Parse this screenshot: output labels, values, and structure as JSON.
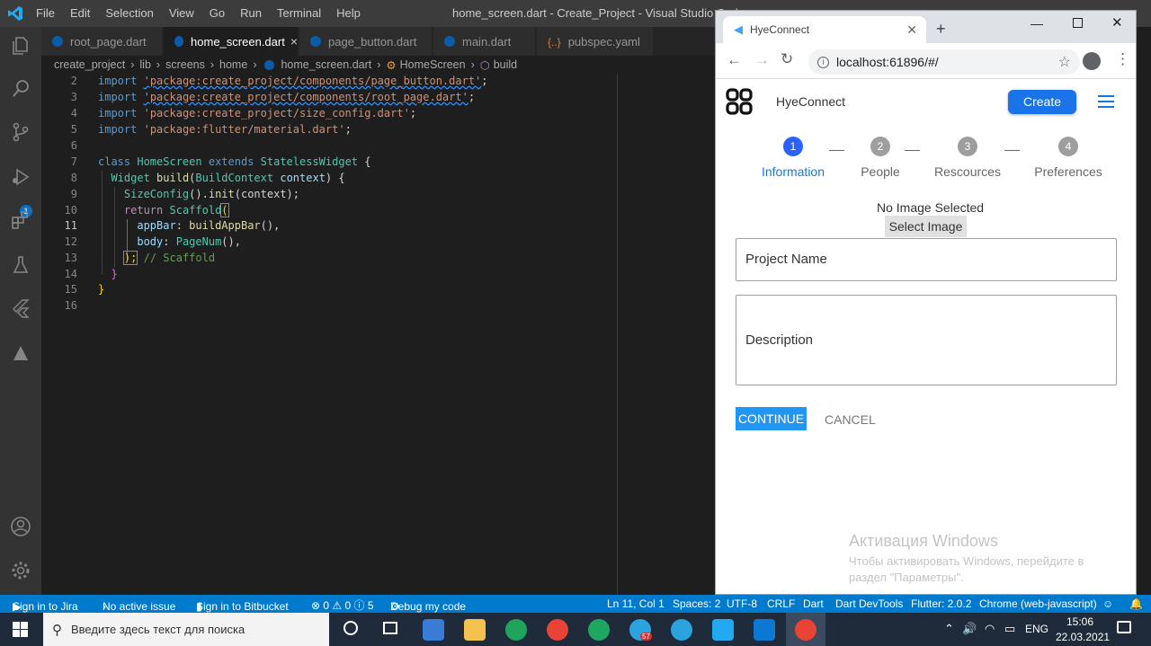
{
  "titlebar": {
    "menu": [
      "File",
      "Edit",
      "Selection",
      "View",
      "Go",
      "Run",
      "Terminal",
      "Help"
    ],
    "window_title": "home_screen.dart - Create_Project - Visual Studio Code"
  },
  "tabs": [
    {
      "label": "root_page.dart"
    },
    {
      "label": "home_screen.dart",
      "close": "×"
    },
    {
      "label": "page_button.dart"
    },
    {
      "label": "main.dart"
    },
    {
      "label": "pubspec.yaml"
    }
  ],
  "breadcrumb": [
    "create_project",
    "lib",
    "screens",
    "home",
    "home_screen.dart",
    "HomeScreen",
    "build"
  ],
  "activity_badge": "1",
  "editor": {
    "line_numbers": [
      "2",
      "3",
      "4",
      "5",
      "6",
      "7",
      "8",
      "9",
      "10",
      "11",
      "12",
      "13",
      "14",
      "15",
      "16"
    ],
    "lines": {
      "l2": {
        "kw": "import",
        "str": "'package:create_project/components/page_button.dart'",
        "end": ";"
      },
      "l3": {
        "kw": "import",
        "str": "'package:create_project/components/root_page.dart'",
        "end": ";"
      },
      "l4": {
        "kw": "import",
        "str": "'package:create_project/size_config.dart'",
        "end": ";"
      },
      "l5": {
        "kw": "import",
        "str": "'package:flutter/material.dart'",
        "end": ";"
      },
      "l7": {
        "kw1": "class",
        "ty1": "HomeScreen",
        "kw2": "extends",
        "ty2": "StatelessWidget",
        "end": " {"
      },
      "l8": {
        "ty": "Widget",
        "fn": "build",
        "p1": "(",
        "ty2": "BuildContext",
        "vr": "context",
        "p2": ") {"
      },
      "l9": {
        "ty": "SizeConfig",
        "p1": "().",
        "fn": "init",
        "p2": "(context);"
      },
      "l10": {
        "ctl": "return",
        "ty": "Scaffold",
        "p": "("
      },
      "l11": {
        "vr": "appBar",
        "p1": ": ",
        "fn": "buildAppBar",
        "p2": "(),"
      },
      "l12": {
        "vr": "body",
        "p1": ": ",
        "ty": "PageNum",
        "p2": "(),"
      },
      "l13": {
        "p": ");",
        "cm": "// Scaffold"
      },
      "l14": {
        "p": "}"
      },
      "l15": {
        "p": "}"
      }
    }
  },
  "statusbar": {
    "jira": "Sign in to Jira",
    "issue": "No active issue",
    "bitbucket": "Sign in to Bitbucket",
    "problems": "⊗ 0 ⚠ 0 ⓘ 5",
    "debug": "Debug my code",
    "position": "Ln 11, Col 1",
    "spaces": "Spaces: 2",
    "encoding": "UTF-8",
    "eol": "CRLF",
    "language": "Dart",
    "devtools": "Dart DevTools",
    "flutter": "Flutter: 2.0.2",
    "device": "Chrome (web-javascript)"
  },
  "chrome": {
    "tab_title": "HyeConnect",
    "url": "localhost:61896/#/"
  },
  "app": {
    "title": "HyeConnect",
    "create_label": "Create",
    "steps": [
      {
        "num": "1",
        "label": "Information"
      },
      {
        "num": "2",
        "label": "People"
      },
      {
        "num": "3",
        "label": "Rescources"
      },
      {
        "num": "4",
        "label": "Preferences"
      }
    ],
    "no_image": "No Image Selected",
    "select_image": "Select Image",
    "project_name_placeholder": "Project Name",
    "description_placeholder": "Description",
    "continue_label": "CONTINUE",
    "cancel_label": "CANCEL"
  },
  "watermark": {
    "title": "Активация Windows",
    "text": "Чтобы активировать Windows, перейдите в раздел \"Параметры\"."
  },
  "taskbar": {
    "search_placeholder": "Введите здесь текст для поиска",
    "language": "ENG",
    "time": "15:06",
    "date": "22.03.2021",
    "telegram_badge": "57"
  },
  "colors": {
    "accent": "#007acc",
    "primary": "#1a73e8",
    "step_active": "#2962ff"
  }
}
